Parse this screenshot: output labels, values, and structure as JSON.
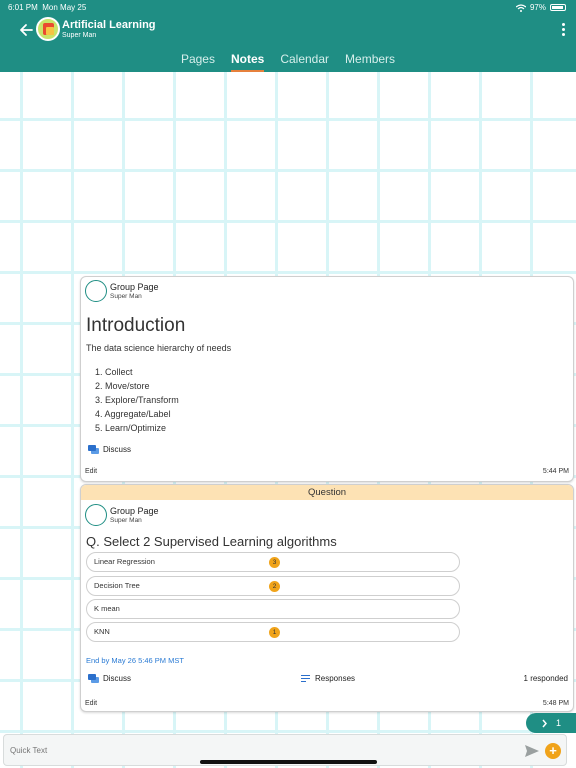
{
  "status": {
    "time": "6:01 PM",
    "date": "Mon May 25",
    "battery": "97%"
  },
  "app": {
    "title": "Artificial Learning",
    "subtitle": "Super Man"
  },
  "tabs": [
    {
      "label": "Pages"
    },
    {
      "label": "Notes"
    },
    {
      "label": "Calendar"
    },
    {
      "label": "Members"
    }
  ],
  "active_tab": "Notes",
  "note_card": {
    "author": "Group Page",
    "author_sub": "Super Man",
    "title": "Introduction",
    "text": "The data science hierarchy of needs",
    "list": [
      "1.  Collect",
      "2.  Move/store",
      "3.  Explore/Transform",
      "4.  Aggregate/Label",
      "5.  Learn/Optimize"
    ],
    "discuss_label": "Discuss",
    "edit_label": "Edit",
    "time": "5:44 PM"
  },
  "question_card": {
    "banner": "Question",
    "author": "Group Page",
    "author_sub": "Super Man",
    "title": "Q. Select 2 Supervised Learning algorithms",
    "options": [
      {
        "label": "Linear Regression",
        "count": "3"
      },
      {
        "label": "Decision Tree",
        "count": "2"
      },
      {
        "label": "K mean",
        "count": ""
      },
      {
        "label": "KNN",
        "count": "1"
      }
    ],
    "deadline": "End by May 26 5:46 PM MST",
    "discuss_label": "Discuss",
    "responses_label": "Responses",
    "responded": "1 responded",
    "edit_label": "Edit",
    "time": "5:48 PM"
  },
  "pager": {
    "label": "1"
  },
  "quick_text": {
    "placeholder": "Quick Text"
  },
  "colors": {
    "header": "#1f8e84",
    "accent": "#f0a31a",
    "banner": "#fde2b4",
    "link": "#2b7bd4"
  }
}
